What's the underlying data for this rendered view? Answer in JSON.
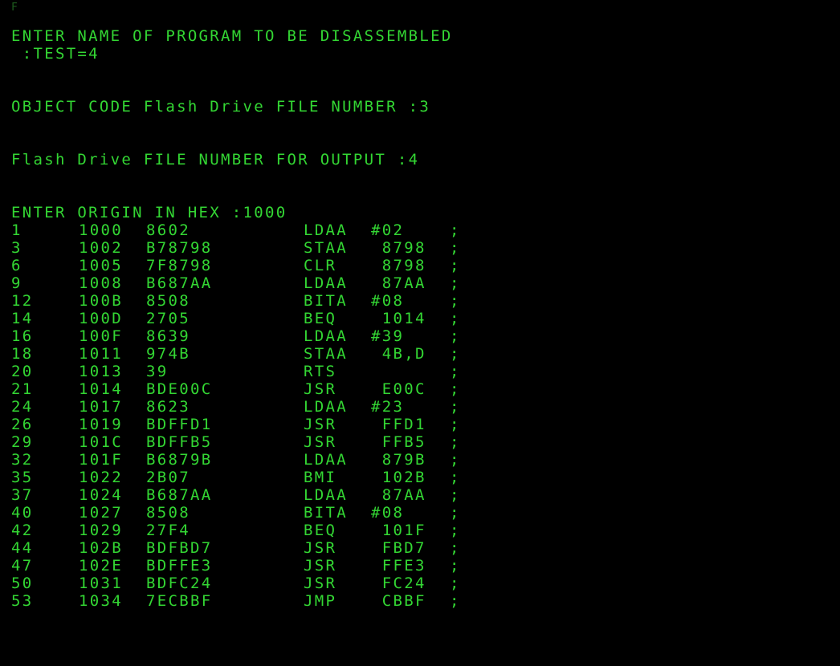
{
  "terminal": {
    "corner_glyph": "F",
    "prompt_name": "ENTER NAME OF PROGRAM TO BE DISASSEMBLED",
    "input_name": " :TEST=4",
    "prompt_object": "OBJECT CODE Flash Drive FILE NUMBER :3",
    "prompt_output": "Flash Drive FILE NUMBER FOR OUTPUT :4",
    "prompt_origin": "ENTER ORIGIN IN HEX :1000",
    "colors": {
      "background": "#000000",
      "text": "#33d633"
    }
  },
  "listing": [
    {
      "line": "1",
      "addr": "1000",
      "obj": "8602",
      "mnem": "LDAA",
      "oper": "#02",
      "semi": ";"
    },
    {
      "line": "3",
      "addr": "1002",
      "obj": "B78798",
      "mnem": "STAA",
      "oper": " 8798",
      "semi": ";"
    },
    {
      "line": "6",
      "addr": "1005",
      "obj": "7F8798",
      "mnem": "CLR",
      "oper": " 8798",
      "semi": ";"
    },
    {
      "line": "9",
      "addr": "1008",
      "obj": "B687AA",
      "mnem": "LDAA",
      "oper": " 87AA",
      "semi": ";"
    },
    {
      "line": "12",
      "addr": "100B",
      "obj": "8508",
      "mnem": "BITA",
      "oper": "#08",
      "semi": ";"
    },
    {
      "line": "14",
      "addr": "100D",
      "obj": "2705",
      "mnem": "BEQ",
      "oper": " 1014",
      "semi": ";"
    },
    {
      "line": "16",
      "addr": "100F",
      "obj": "8639",
      "mnem": "LDAA",
      "oper": "#39",
      "semi": ";"
    },
    {
      "line": "18",
      "addr": "1011",
      "obj": "974B",
      "mnem": "STAA",
      "oper": " 4B,D",
      "semi": ";"
    },
    {
      "line": "20",
      "addr": "1013",
      "obj": "39",
      "mnem": "RTS",
      "oper": "",
      "semi": ";"
    },
    {
      "line": "21",
      "addr": "1014",
      "obj": "BDE00C",
      "mnem": "JSR",
      "oper": " E00C",
      "semi": ";"
    },
    {
      "line": "24",
      "addr": "1017",
      "obj": "8623",
      "mnem": "LDAA",
      "oper": "#23",
      "semi": ";"
    },
    {
      "line": "26",
      "addr": "1019",
      "obj": "BDFFD1",
      "mnem": "JSR",
      "oper": " FFD1",
      "semi": ";"
    },
    {
      "line": "29",
      "addr": "101C",
      "obj": "BDFFB5",
      "mnem": "JSR",
      "oper": " FFB5",
      "semi": ";"
    },
    {
      "line": "32",
      "addr": "101F",
      "obj": "B6879B",
      "mnem": "LDAA",
      "oper": " 879B",
      "semi": ";"
    },
    {
      "line": "35",
      "addr": "1022",
      "obj": "2B07",
      "mnem": "BMI",
      "oper": " 102B",
      "semi": ";"
    },
    {
      "line": "37",
      "addr": "1024",
      "obj": "B687AA",
      "mnem": "LDAA",
      "oper": " 87AA",
      "semi": ";"
    },
    {
      "line": "40",
      "addr": "1027",
      "obj": "8508",
      "mnem": "BITA",
      "oper": "#08",
      "semi": ";"
    },
    {
      "line": "42",
      "addr": "1029",
      "obj": "27F4",
      "mnem": "BEQ",
      "oper": " 101F",
      "semi": ";"
    },
    {
      "line": "44",
      "addr": "102B",
      "obj": "BDFBD7",
      "mnem": "JSR",
      "oper": " FBD7",
      "semi": ";"
    },
    {
      "line": "47",
      "addr": "102E",
      "obj": "BDFFE3",
      "mnem": "JSR",
      "oper": " FFE3",
      "semi": ";"
    },
    {
      "line": "50",
      "addr": "1031",
      "obj": "BDFC24",
      "mnem": "JSR",
      "oper": " FC24",
      "semi": ";"
    },
    {
      "line": "53",
      "addr": "1034",
      "obj": "7ECBBF",
      "mnem": "JMP",
      "oper": " CBBF",
      "semi": ";"
    }
  ]
}
